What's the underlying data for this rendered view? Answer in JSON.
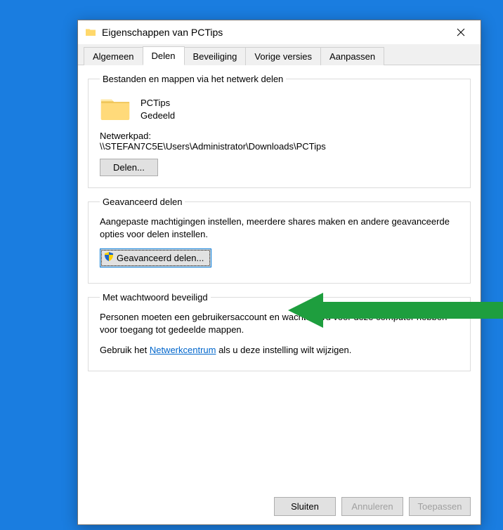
{
  "window": {
    "title": "Eigenschappen van PCTips"
  },
  "tabs": {
    "items": [
      {
        "label": "Algemeen"
      },
      {
        "label": "Delen"
      },
      {
        "label": "Beveiliging"
      },
      {
        "label": "Vorige versies"
      },
      {
        "label": "Aanpassen"
      }
    ],
    "active_index": 1
  },
  "share_group": {
    "legend": "Bestanden en mappen via het netwerk delen",
    "folder_name": "PCTips",
    "status": "Gedeeld",
    "netpath_label": "Netwerkpad:",
    "netpath_value": "\\\\STEFAN7C5E\\Users\\Administrator\\Downloads\\PCTips",
    "share_button": "Delen..."
  },
  "advanced_group": {
    "legend": "Geavanceerd delen",
    "description": "Aangepaste machtigingen instellen, meerdere shares maken en andere geavanceerde opties voor delen instellen.",
    "button": "Geavanceerd delen..."
  },
  "password_group": {
    "legend": "Met wachtwoord beveiligd",
    "line1": "Personen moeten een gebruikersaccount en wachtwoord voor deze computer hebben voor toegang tot gedeelde mappen.",
    "line2_prefix": "Gebruik het ",
    "link": "Netwerkcentrum",
    "line2_suffix": " als u deze instelling wilt wijzigen."
  },
  "buttons": {
    "close": "Sluiten",
    "cancel": "Annuleren",
    "apply": "Toepassen"
  }
}
